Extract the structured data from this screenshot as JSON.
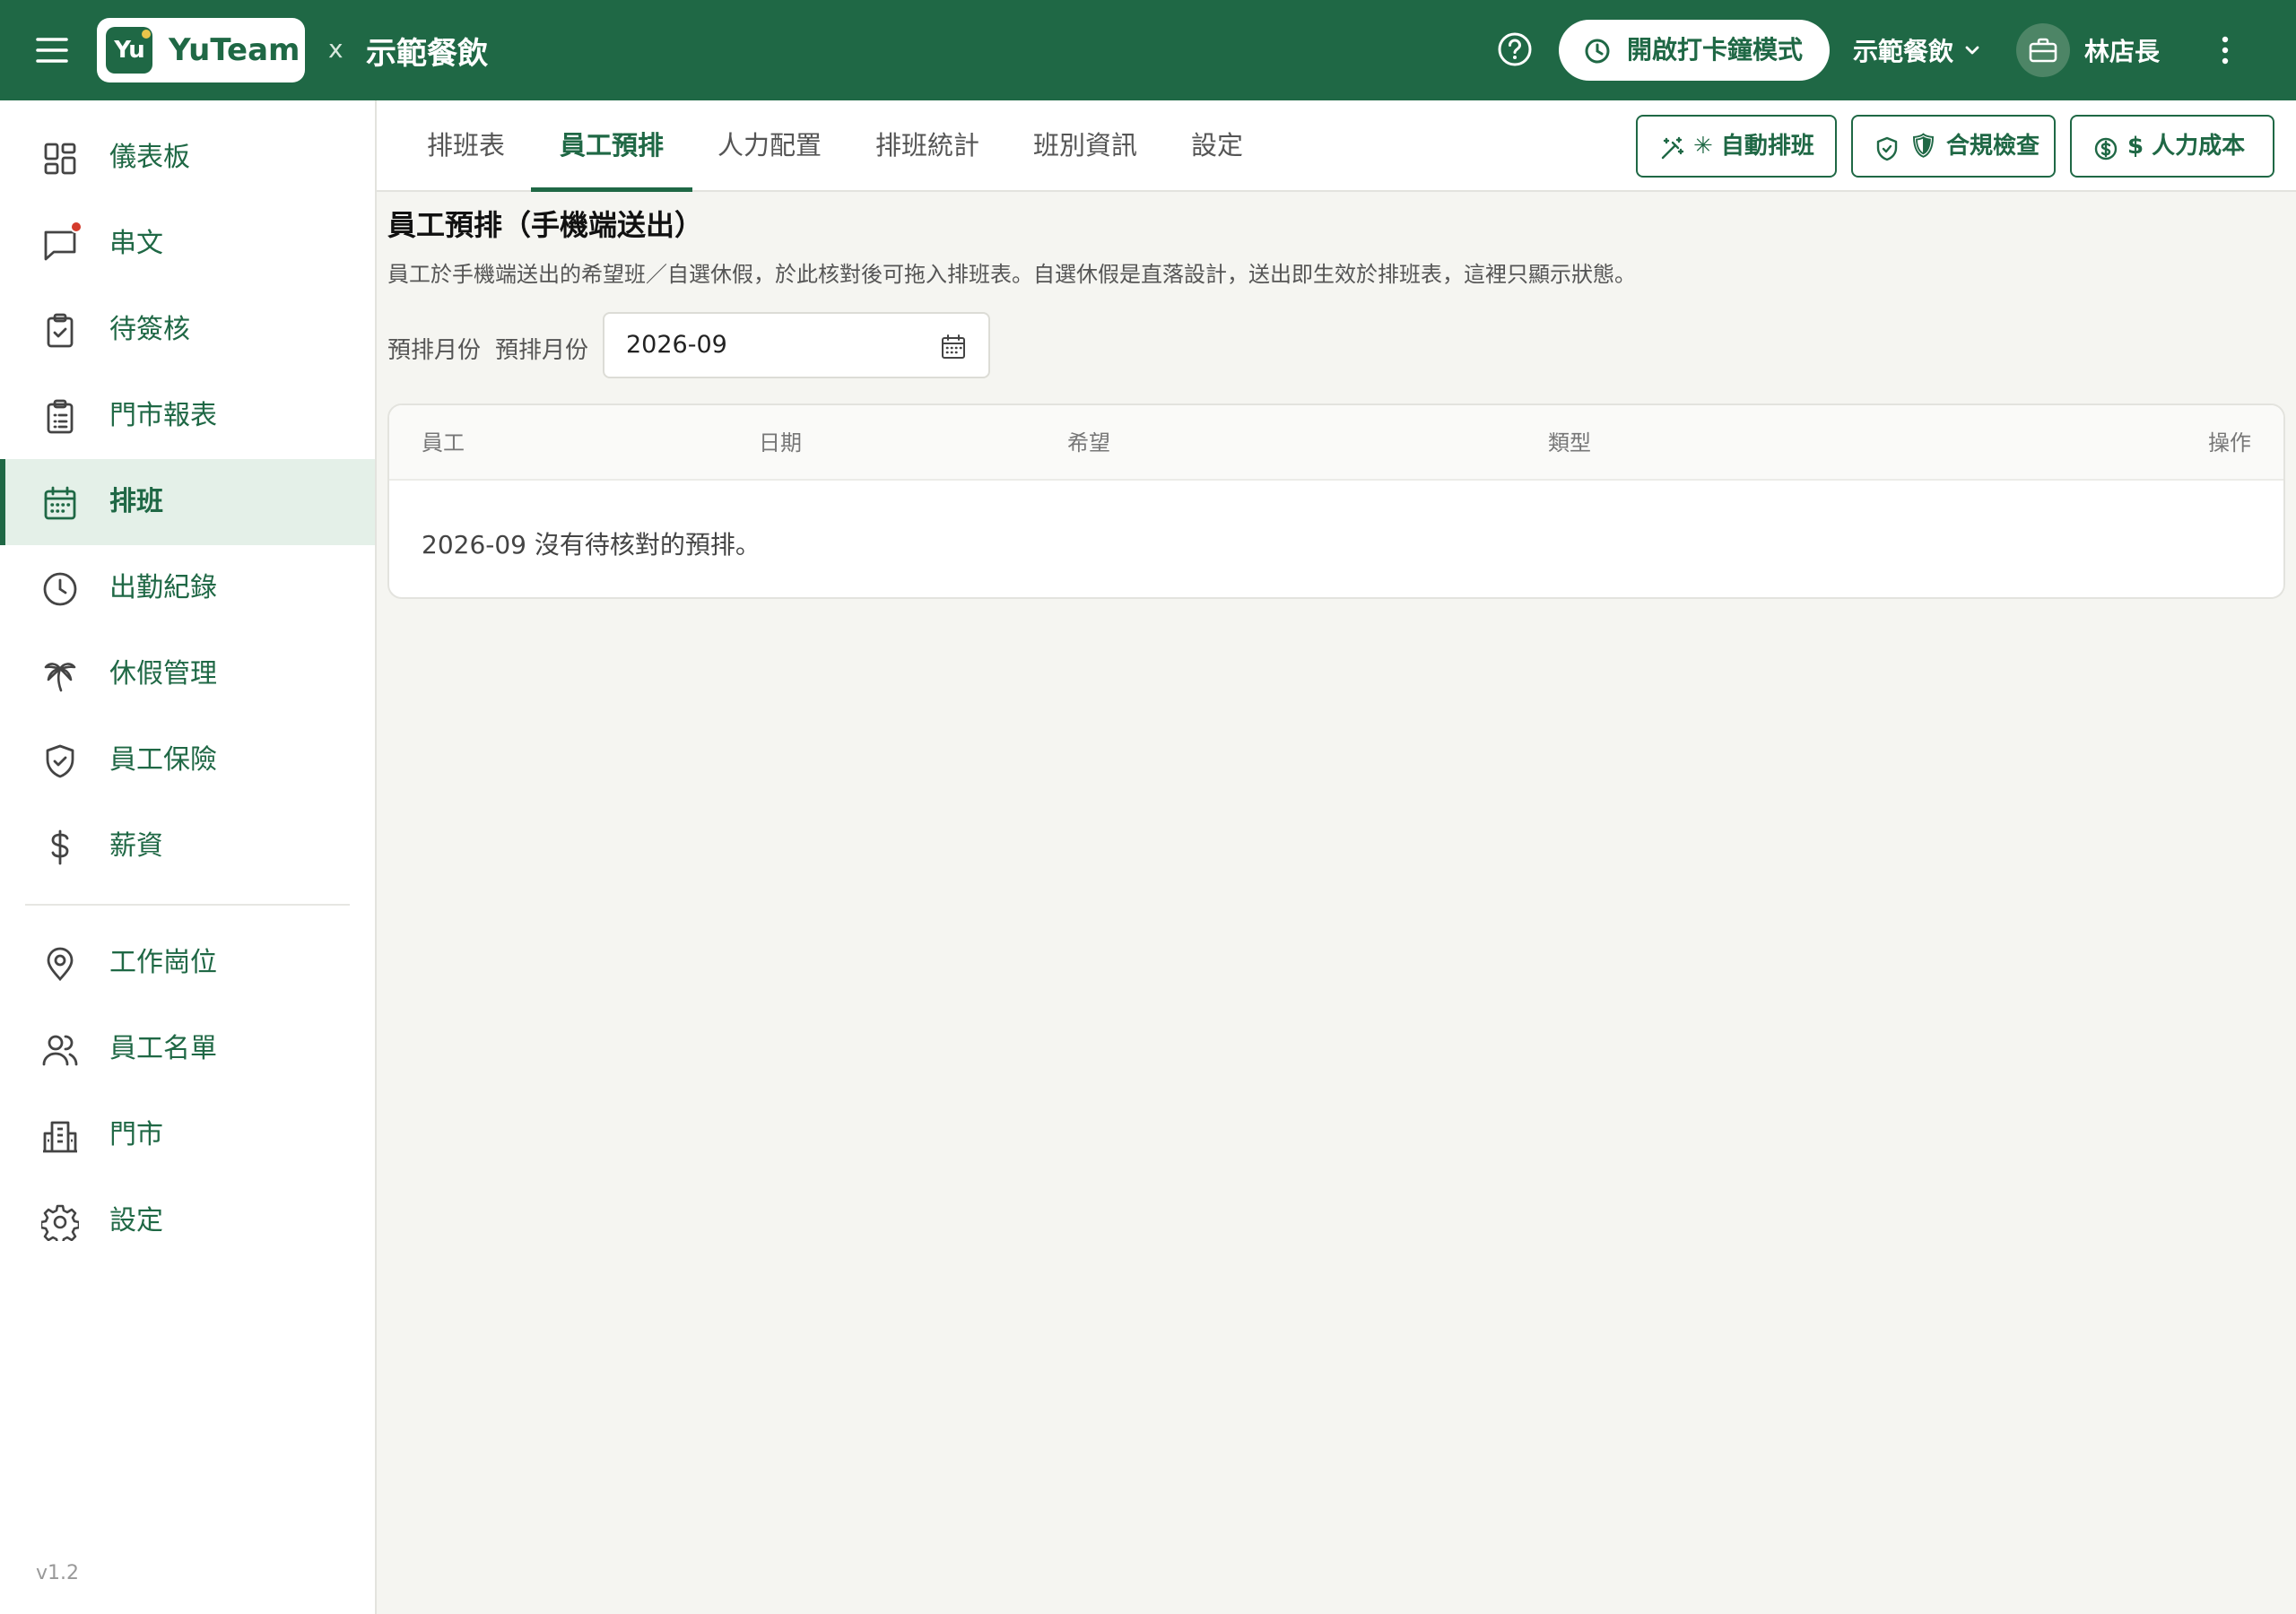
{
  "topbar": {
    "brand_mark": "Yu",
    "brand_name": "YuTeam",
    "separator": "x",
    "org_name": "示範餐飲",
    "clock_mode_label": "開啟打卡鐘模式",
    "org_switch_label": "示範餐飲",
    "user_name": "林店長"
  },
  "sidebar": {
    "items": [
      {
        "label": "儀表板",
        "icon": "dashboard-icon"
      },
      {
        "label": "串文",
        "icon": "chat-icon",
        "badge": true
      },
      {
        "label": "待簽核",
        "icon": "clipboard-check-icon"
      },
      {
        "label": "門市報表",
        "icon": "clipboard-list-icon"
      },
      {
        "label": "排班",
        "icon": "calendar-icon",
        "active": true
      },
      {
        "label": "出勤紀錄",
        "icon": "clock-icon"
      },
      {
        "label": "休假管理",
        "icon": "palm-tree-icon"
      },
      {
        "label": "員工保險",
        "icon": "shield-check-icon"
      },
      {
        "label": "薪資",
        "icon": "dollar-icon"
      },
      {
        "label": "工作崗位",
        "icon": "map-pin-icon"
      },
      {
        "label": "員工名單",
        "icon": "users-icon"
      },
      {
        "label": "門市",
        "icon": "building-icon"
      },
      {
        "label": "設定",
        "icon": "gear-icon"
      }
    ],
    "version": "v1.2"
  },
  "tabs": [
    {
      "label": "排班表"
    },
    {
      "label": "員工預排",
      "active": true
    },
    {
      "label": "人力配置"
    },
    {
      "label": "排班統計"
    },
    {
      "label": "班別資訊"
    },
    {
      "label": "設定"
    }
  ],
  "toolbar": {
    "auto_schedule": "✳ 自動排班",
    "compliance": "🛡 合規檢查",
    "labor_cost": "$ 人力成本"
  },
  "main": {
    "title": "員工預排（手機端送出）",
    "description": "員工於手機端送出的希望班／自選休假，於此核對後可拖入排班表。自選休假是直落設計，送出即生效於排班表，這裡只顯示狀態。",
    "month_label_1": "預排月份",
    "month_label_2": "預排月份",
    "month_value": "2026-09",
    "table": {
      "headers": [
        "員工",
        "日期",
        "希望",
        "類型",
        "操作"
      ],
      "empty_message": "2026-09 沒有待核對的預排。"
    }
  },
  "colors": {
    "brand": "#1f6845",
    "badge": "#d43b2c",
    "logo_dot": "#e9c44a"
  }
}
